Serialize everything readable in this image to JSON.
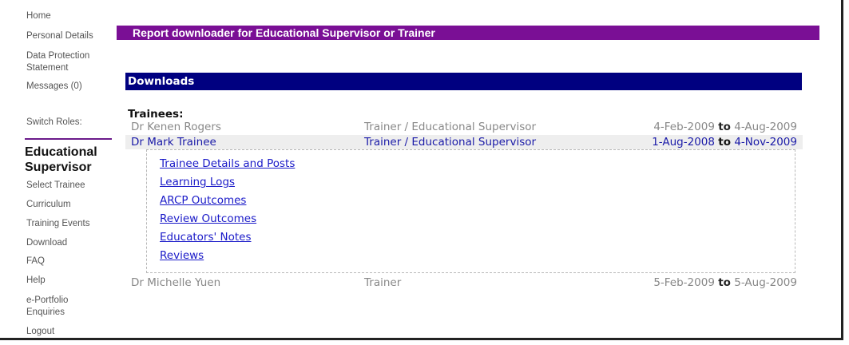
{
  "sidebar": {
    "items": [
      {
        "label": "Home"
      },
      {
        "label": "Personal Details"
      },
      {
        "label": "Data Protection"
      },
      {
        "label": "Statement"
      },
      {
        "label": "Messages (0)"
      },
      {
        "label": "Switch Roles:"
      }
    ],
    "role_title_line1": "Educational",
    "role_title_line2": "Supervisor",
    "role_items": [
      {
        "label": "Select Trainee"
      },
      {
        "label": "Curriculum"
      },
      {
        "label": "Training Events"
      },
      {
        "label": "Download"
      },
      {
        "label": "FAQ"
      },
      {
        "label": "Help"
      },
      {
        "label": "e-Portfolio"
      },
      {
        "label": "Enquiries"
      },
      {
        "label": "Logout"
      }
    ]
  },
  "main": {
    "title": "Report downloader for Educational Supervisor or Trainer",
    "section_title": "Downloads",
    "trainees_label": "Trainees:",
    "to_word": "to",
    "trainees": [
      {
        "name": "Dr Kenen Rogers",
        "role": "Trainer / Educational Supervisor",
        "from": "4-Feb-2009",
        "to": "4-Aug-2009"
      },
      {
        "name": "Dr Mark Trainee",
        "role": "Trainer / Educational Supervisor",
        "from": "1-Aug-2008",
        "to": "4-Nov-2009"
      },
      {
        "name": "Dr Michelle Yuen",
        "role": "Trainer",
        "from": "5-Feb-2009",
        "to": "5-Aug-2009"
      }
    ],
    "report_links": [
      {
        "label": "Trainee Details and Posts"
      },
      {
        "label": "Learning Logs"
      },
      {
        "label": "ARCP Outcomes"
      },
      {
        "label": "Review Outcomes"
      },
      {
        "label": "Educators' Notes"
      },
      {
        "label": "Reviews"
      }
    ]
  },
  "colors": {
    "title_bar": "#7a0f95",
    "section_bar": "#000080",
    "link": "#1a1ac8"
  }
}
